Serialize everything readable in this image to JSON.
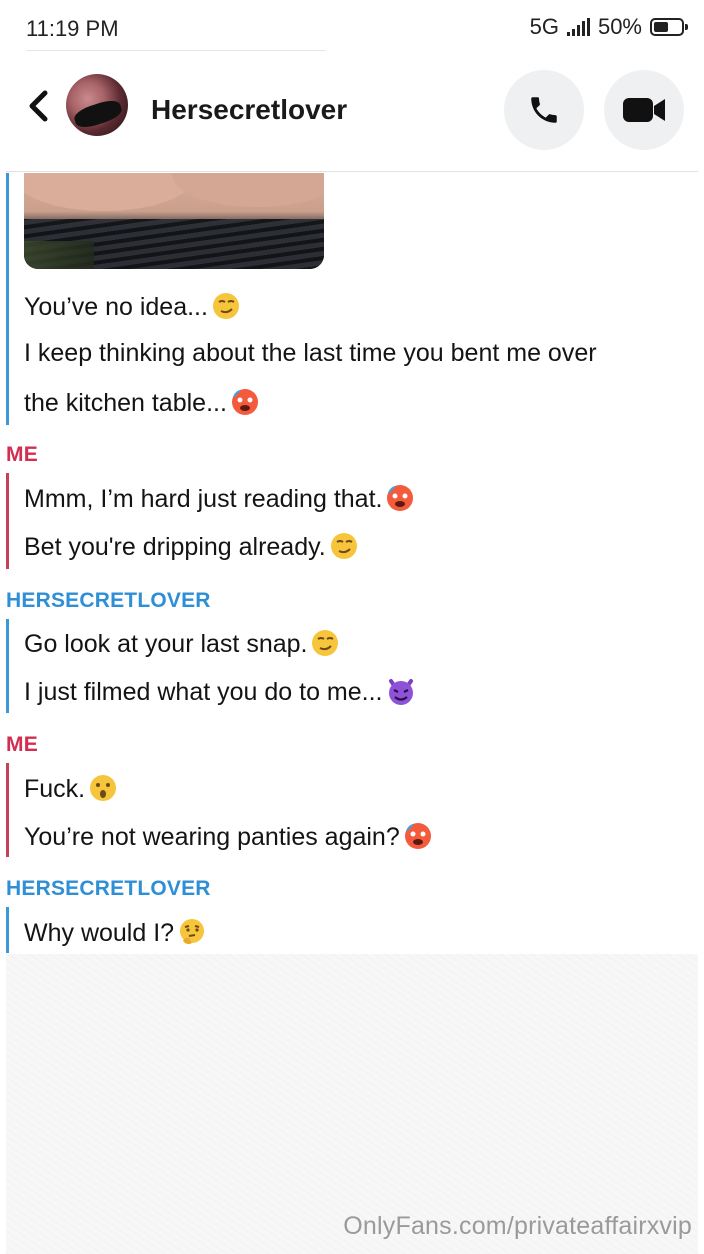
{
  "status_bar": {
    "time": "11:19 PM",
    "network": "5G",
    "battery": "50%"
  },
  "header": {
    "contact_name": "Hersecretlover"
  },
  "colors": {
    "me": "#d22e52",
    "her": "#2f8fd6",
    "emoji": "#f7c53b"
  },
  "messages": {
    "her1": {
      "line1": "You’ve no idea...",
      "line2": "I keep thinking about the last time you bent me over",
      "line3": "the kitchen table..."
    },
    "me1": {
      "sender": "ME",
      "line1": "Mmm, I’m hard just reading that.",
      "line2": "Bet you're dripping already."
    },
    "her2": {
      "sender": "HERSECRETLOVER",
      "line1": "Go look at your last snap.",
      "line2": "I just filmed what you do to me..."
    },
    "me2": {
      "sender": "ME",
      "line1": "Fuck.",
      "line2": "You’re not wearing panties again?"
    },
    "her3": {
      "sender": "HERSECRETLOVER",
      "line1": "Why would I?"
    }
  },
  "watermark": "OnlyFans.com/privateaffairxvip"
}
